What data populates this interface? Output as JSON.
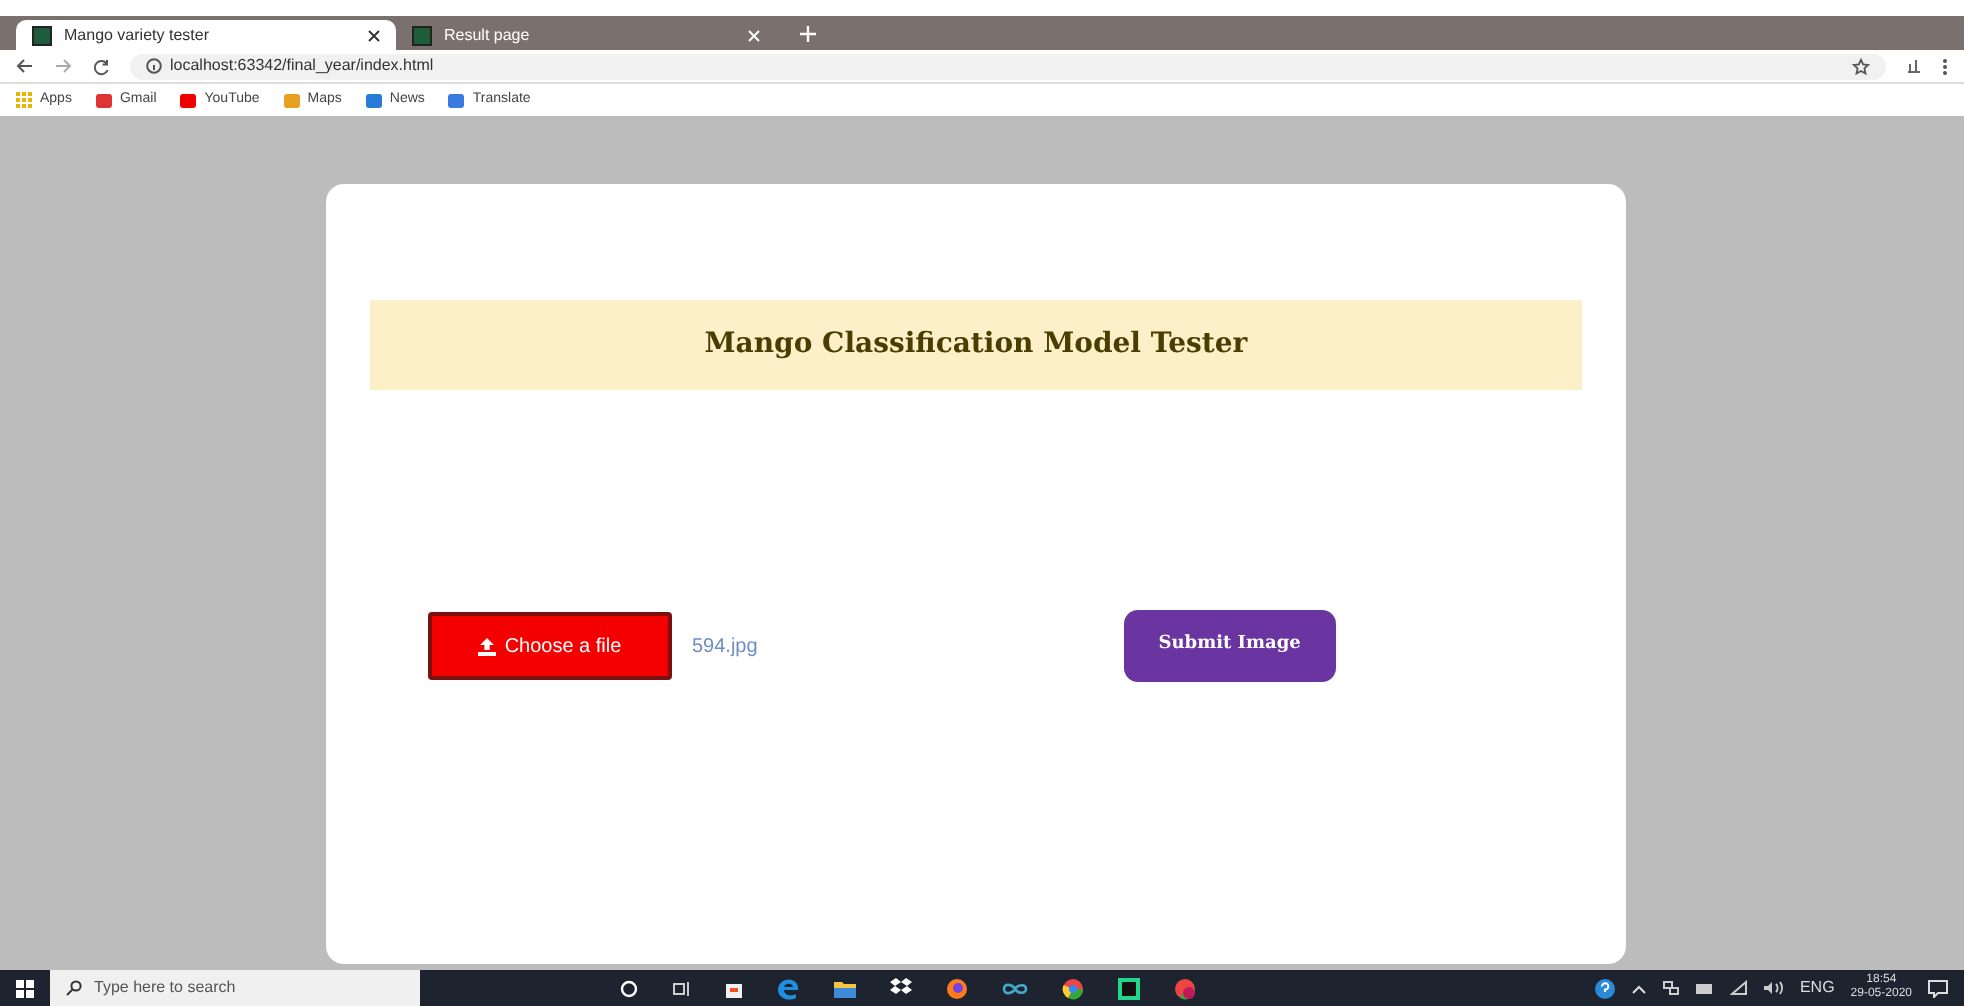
{
  "browser": {
    "tabs": [
      {
        "title": "Mango variety tester",
        "selected": true
      },
      {
        "title": "Result page",
        "selected": false
      }
    ],
    "url": "localhost:63342/final_year/index.html",
    "bookmarks": [
      "Apps",
      "Gmail",
      "YouTube",
      "Maps",
      "News",
      "Translate"
    ]
  },
  "page": {
    "heading": "Mango Classification Model Tester",
    "file_button": "Choose a file",
    "file_name": "594.jpg",
    "submit_button": "Submit Image"
  },
  "taskbar": {
    "search_placeholder": "Type here to search",
    "language": "ENG",
    "time": "18:54",
    "date": "29-05-2020"
  }
}
